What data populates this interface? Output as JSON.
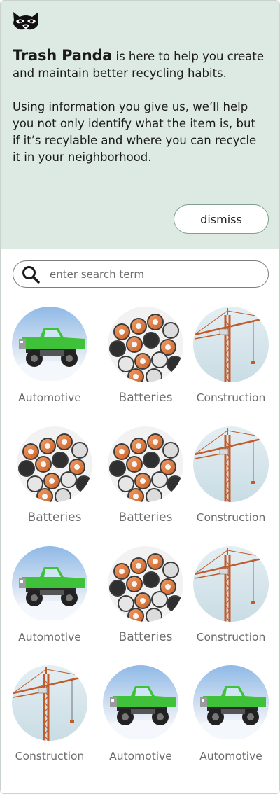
{
  "app": {
    "brand": "Trash Panda",
    "logo_icon": "raccoon-icon"
  },
  "intro": {
    "rest": " is here to help you create and maintain better recycling habits.",
    "paragraph2": "Using information you give us, we’ll help you not only identify what the item is, but if it’s recylable and where you can recycle it in your neighborhood.",
    "dismiss_label": "dismiss"
  },
  "search": {
    "placeholder": "enter search term",
    "icon": "search-icon"
  },
  "categories": [
    {
      "label": "Automotive",
      "image": "truck"
    },
    {
      "label": "Batteries",
      "image": "batteries"
    },
    {
      "label": "Construction",
      "image": "crane"
    },
    {
      "label": "Batteries",
      "image": "batteries"
    },
    {
      "label": "Batteries",
      "image": "batteries"
    },
    {
      "label": "Construction",
      "image": "crane"
    },
    {
      "label": "Automotive",
      "image": "truck"
    },
    {
      "label": "Batteries",
      "image": "batteries"
    },
    {
      "label": "Construction",
      "image": "crane"
    },
    {
      "label": "Construction",
      "image": "crane"
    },
    {
      "label": "Automotive",
      "image": "truck"
    },
    {
      "label": "Automotive",
      "image": "truck"
    }
  ],
  "colors": {
    "banner": "#dde9e3",
    "dismiss_border": "#7fa08f",
    "label_text": "#6b6b6b"
  }
}
